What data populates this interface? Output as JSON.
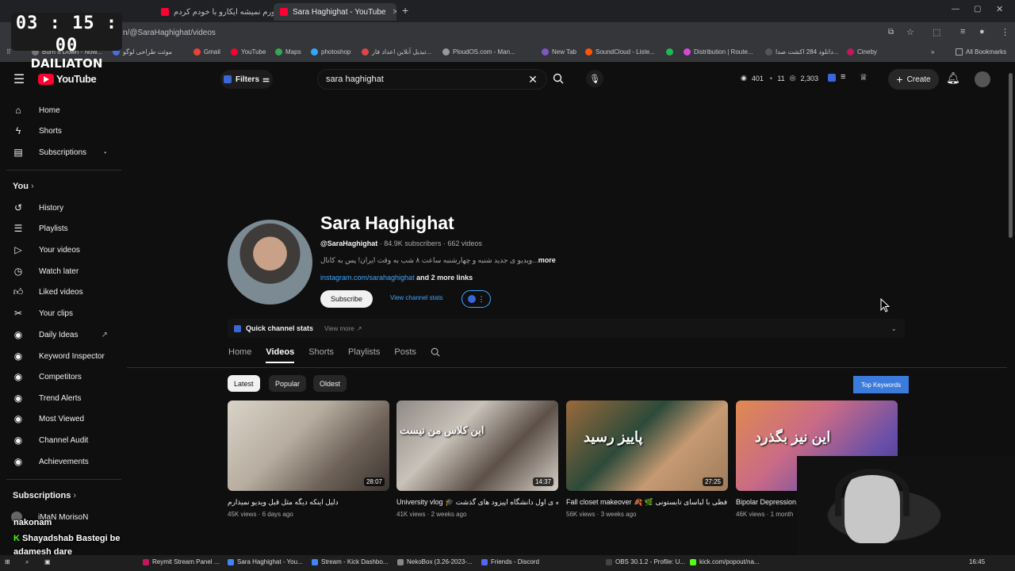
{
  "browser": {
    "tabs": [
      {
        "title": "باورم نمیشه ایکارو با خودم کردم",
        "active": false
      },
      {
        "title": "Sara Haghighat - YouTube",
        "active": true
      }
    ],
    "url": "n/@SaraHaghighat/videos",
    "bookmarks": [
      "Burn It Down - Now...",
      "موئت طراحی لوگو",
      "Gmail",
      "YouTube",
      "Maps",
      "photoshop",
      "تبدیل آنلاین اعداد فار...",
      "PloudOS.com - Man...",
      "New Tab",
      "SoundCloud - Liste...",
      "Distribution | Route...",
      "دانلود 284 اکشت صدا...",
      "Cineby"
    ],
    "all_bookmarks": "All Bookmarks"
  },
  "overlay": {
    "clock": "03 : 15 : 00",
    "name": "DAILIATON"
  },
  "youtube": {
    "logo": "YouTube",
    "filters": "Filters",
    "search_value": "sara haghighat",
    "stats": [
      "401",
      "11",
      "2,303"
    ],
    "create": "Create"
  },
  "sidebar": {
    "main": [
      "Home",
      "Shorts",
      "Subscriptions"
    ],
    "you_header": "You",
    "you": [
      "History",
      "Playlists",
      "Your videos",
      "Watch later",
      "Liked videos",
      "Your clips"
    ],
    "tools": [
      "Daily Ideas",
      "Keyword Inspector",
      "Competitors",
      "Trend Alerts",
      "Most Viewed",
      "Channel Audit",
      "Achievements"
    ],
    "subs_header": "Subscriptions",
    "sub_item": "iMaN MorisoN"
  },
  "channel": {
    "name": "Sara Haghighat",
    "handle": "@SaraHaghighat",
    "meta": " · 84.9K subscribers · 662 videos",
    "desc": "ویدیو ی جدید شنبه و چهارشنبه ساعت ۸ شب به وقت ایران! پس به کانال...",
    "more": "more",
    "link": "instagram.com/sarahaghighat",
    "more_links": " and 2 more links",
    "subscribe": "Subscribe",
    "view_stats": "View channel stats",
    "quick_stats": "Quick channel stats",
    "view_more": "View more"
  },
  "tabs": [
    "Home",
    "Videos",
    "Shorts",
    "Playlists",
    "Posts"
  ],
  "chips": [
    "Latest",
    "Popular",
    "Oldest"
  ],
  "top_keywords": "Top Keywords",
  "videos": [
    {
      "title": "دلیل اینکه دیگه مثل قبل ویدیو نمیذارم",
      "meta": "45K views · 6 days ago",
      "duration": "28:07",
      "overlay": ""
    },
    {
      "title": "University vlog 🎓 هفته ی اول دانشگاه اپیزود های گذشت",
      "meta": "41K views · 2 weeks ago",
      "duration": "14:37",
      "overlay": "این کلاس من نیست"
    },
    {
      "title": "Fall closet makeover 🍂 🌿 خداحافظی با لباسای تابستونی",
      "meta": "56K views · 3 weeks ago",
      "duration": "27:25",
      "overlay": "پاییز رسید"
    },
    {
      "title": "Bipolar Depression...",
      "meta": "46K views · 1 month",
      "duration": "",
      "overlay": "این نیز بگذرد"
    }
  ],
  "taskbar": [
    "Reymit Stream Panel ...",
    "Sara Haghighat - You...",
    "Stream - Kick Dashbo...",
    "NekoBox (3.26-2023-...",
    "Friends - Discord",
    "OBS 30.1.2 - Profile: U...",
    "kick.com/popout/na...",
    "16:45"
  ],
  "chat": [
    "nakonam",
    "Shayadshab",
    "Bastegi be",
    "adamesh dare"
  ],
  "colors": {
    "accent": "#3ea6ff",
    "youtube_red": "#ff0033",
    "background": "#0f0f0f"
  }
}
